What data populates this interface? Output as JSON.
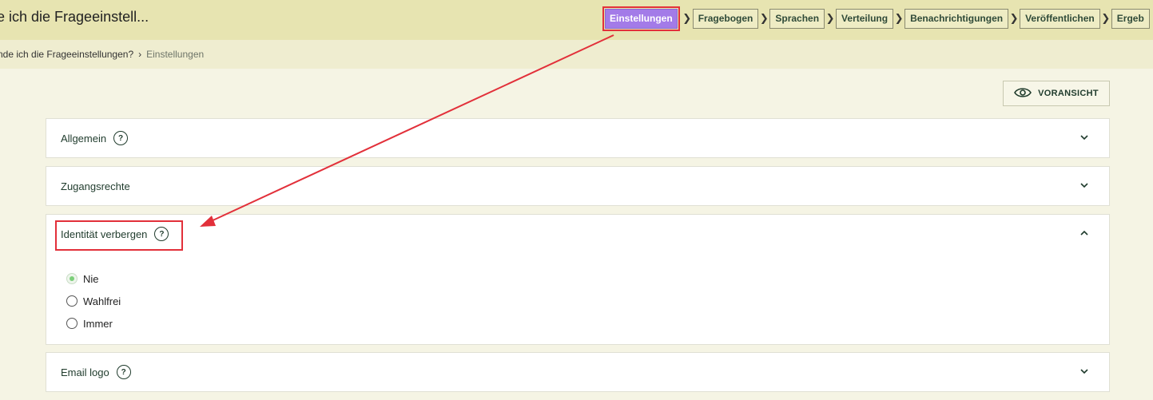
{
  "header": {
    "title": "e ich die Frageeinstell...",
    "steps": [
      {
        "label": "Einstellungen",
        "active": true
      },
      {
        "label": "Fragebogen"
      },
      {
        "label": "Sprachen"
      },
      {
        "label": "Verteilung"
      },
      {
        "label": "Benachrichtigungen"
      },
      {
        "label": "Veröffentlichen"
      },
      {
        "label": "Ergeb"
      }
    ]
  },
  "breadcrumb": {
    "parent": "nde ich die Frageeinstellungen?",
    "current": "Einstellungen"
  },
  "toolbar": {
    "preview_label": "VORANSICHT"
  },
  "panels": [
    {
      "title": "Allgemein",
      "help": "?",
      "expanded": false
    },
    {
      "title": "Zugangsrechte",
      "expanded": false
    },
    {
      "title": "Identität verbergen",
      "help": "?",
      "expanded": true,
      "options": [
        {
          "label": "Nie",
          "checked": true
        },
        {
          "label": "Wahlfrei",
          "checked": false
        },
        {
          "label": "Immer",
          "checked": false
        }
      ]
    },
    {
      "title": "Email logo",
      "help": "?",
      "expanded": false
    }
  ],
  "colors": {
    "active_step": "#a37be8",
    "annotation": "#e2303a",
    "accent_text": "#1f3b2c",
    "radio_checked": "#7ccf7a"
  },
  "icons": {
    "preview": "eye-icon",
    "help": "question-circle-icon",
    "collapsed": "chevron-down-icon",
    "expanded": "chevron-up-icon"
  }
}
